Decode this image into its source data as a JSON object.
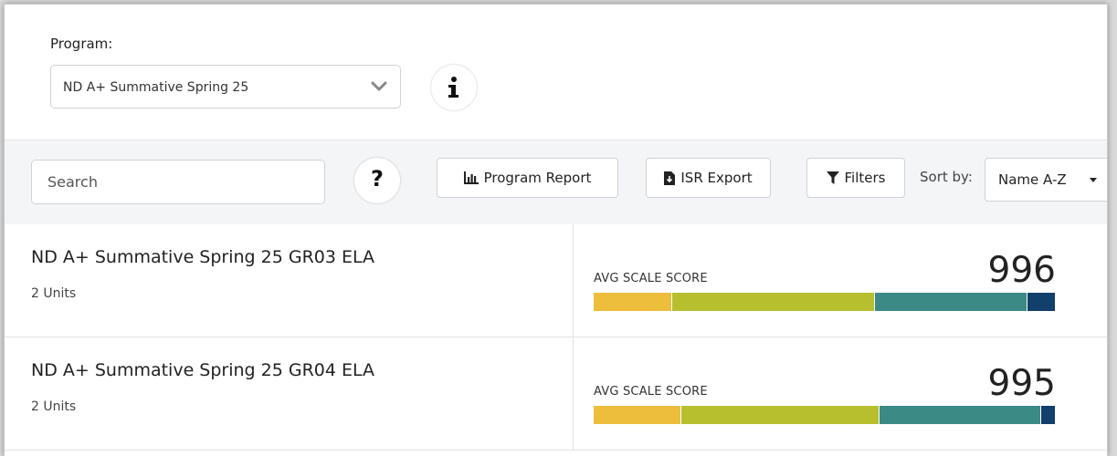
{
  "program": {
    "label": "Program:",
    "selected": "ND A+ Summative Spring 25"
  },
  "icons": {
    "info": "info-icon",
    "help": "question-icon",
    "program_report": "bar-chart-icon",
    "isr_export": "file-download-icon",
    "filters": "filter-icon",
    "chevron": "chevron-down-icon"
  },
  "toolbar": {
    "search_placeholder": "Search",
    "help_label": "?",
    "program_report_label": "Program Report",
    "isr_export_label": "ISR Export",
    "filters_label": "Filters",
    "sort_label": "Sort by:",
    "sort_value": "Name A-Z"
  },
  "rows": [
    {
      "title": "ND A+ Summative Spring 25 GR03 ELA",
      "units": "2 Units",
      "score_label": "AVG SCALE SCORE",
      "score": "996",
      "distribution": [
        0.17,
        0.44,
        0.33,
        0.06
      ]
    },
    {
      "title": "ND A+ Summative Spring 25 GR04 ELA",
      "units": "2 Units",
      "score_label": "AVG SCALE SCORE",
      "score": "995",
      "distribution": [
        0.19,
        0.43,
        0.35,
        0.03
      ]
    }
  ],
  "colors": {
    "level_1": "#edbd3c",
    "level_2": "#b7bf2f",
    "level_3": "#3b8a86",
    "level_4": "#123f6b"
  }
}
